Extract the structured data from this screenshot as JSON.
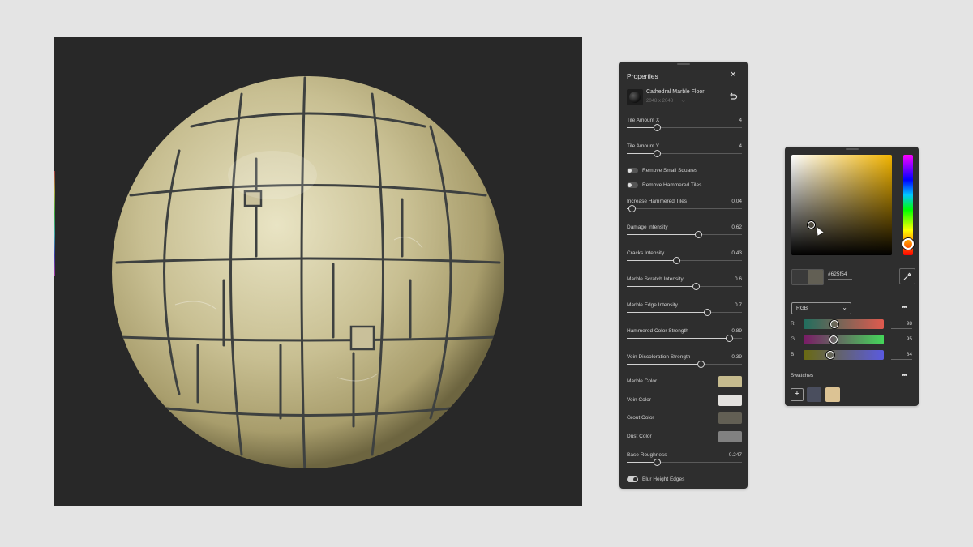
{
  "properties": {
    "title": "Properties",
    "close_icon": "close-icon",
    "material": {
      "name": "Cathedral Marble Floor",
      "resolution": "2048 x 2048"
    },
    "sliders": [
      {
        "label": "Tile Amount X",
        "value": "4",
        "level": 0.26
      },
      {
        "label": "Tile Amount Y",
        "value": "4",
        "level": 0.26
      },
      {
        "label": "Increase Hammered Tiles",
        "value": "0.04",
        "level": 0.04
      },
      {
        "label": "Damage Intensity",
        "value": "0.62",
        "level": 0.62
      },
      {
        "label": "Cracks Intensity",
        "value": "0.43",
        "level": 0.43
      },
      {
        "label": "Marble Scratch Intensity",
        "value": "0.6",
        "level": 0.6
      },
      {
        "label": "Marble Edge Intensity",
        "value": "0.7",
        "level": 0.7
      },
      {
        "label": "Hammered Color Strength",
        "value": "0.89",
        "level": 0.89
      },
      {
        "label": "Vein Discoloration Strength",
        "value": "0.39",
        "level": 0.64
      },
      {
        "label": "Base Roughness",
        "value": "0.247",
        "level": 0.26
      }
    ],
    "toggles": [
      {
        "label": "Remove Small Squares",
        "on": false
      },
      {
        "label": "Remove Hammered Tiles",
        "on": false
      },
      {
        "label": "Blur Height Edges",
        "on": true
      }
    ],
    "colors": [
      {
        "label": "Marble Color",
        "color": "#c6bb8e"
      },
      {
        "label": "Vein Color",
        "color": "#e3e1de"
      },
      {
        "label": "Grout Color",
        "color": "#625f54"
      },
      {
        "label": "Dust Color",
        "color": "#818181"
      }
    ]
  },
  "color_picker": {
    "hex": "#625f54",
    "mode": "RGB",
    "channels": [
      {
        "label": "R",
        "value": "98",
        "gradient": "linear-gradient(to right, #1f6e5e, #e05a4e)"
      },
      {
        "label": "G",
        "value": "95",
        "gradient": "linear-gradient(to right, #7a1a66, #44d75a)"
      },
      {
        "label": "B",
        "value": "84",
        "gradient": "linear-gradient(to right, #6a6a10, #5a5ae0)"
      }
    ],
    "hue_level": 0.88,
    "old_color": "#3a3a3a",
    "new_color": "#625f54",
    "swatches_title": "Swatches",
    "add_label": "+",
    "swatches": [
      "#4a4e5e",
      "#dcc394"
    ]
  }
}
